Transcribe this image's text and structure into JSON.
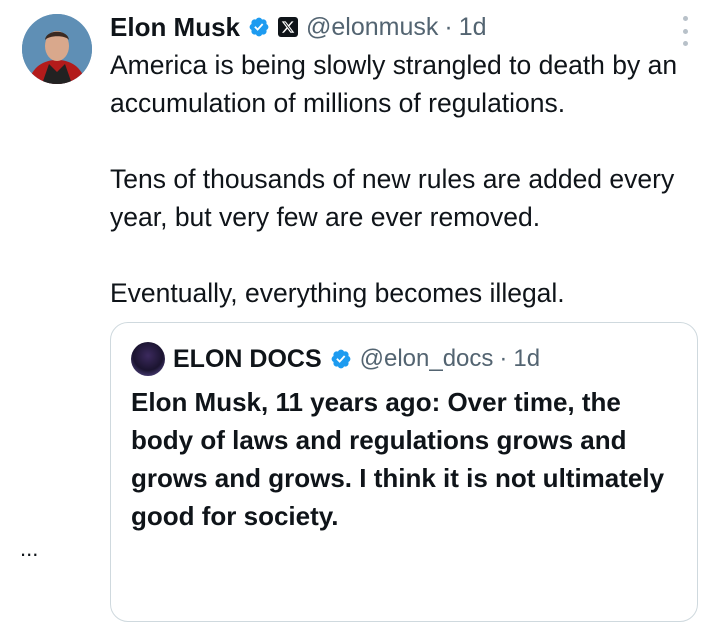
{
  "tweet": {
    "author_name": "Elon Musk",
    "handle": "@elonmusk",
    "separator": "·",
    "time": "1d",
    "paragraphs": [
      "America is being slowly strangled to death by an accumulation of millions of regulations.",
      "Tens of thousands of new rules are added every year, but very few are ever removed.",
      "Eventually, everything becomes illegal."
    ]
  },
  "quote": {
    "author_name": "ELON DOCS",
    "handle": "@elon_docs",
    "separator": "·",
    "time": "1d",
    "text": "Elon Musk, 11 years ago: Over time, the body of laws and regulations grows and grows and grows. I think it is not ultimately good for society.",
    "ellipsis": "..."
  },
  "colors": {
    "verified_blue": "#1d9bf0",
    "secondary_text": "#536471",
    "border": "#cfd9de"
  },
  "icons": {
    "verified": "verified-badge-icon",
    "x_badge": "x-logo-icon",
    "more": "more-vertical-icon"
  }
}
